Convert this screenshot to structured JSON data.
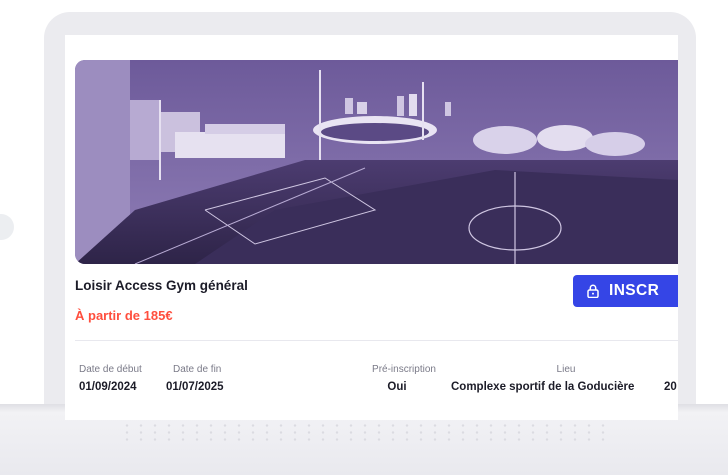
{
  "course": {
    "title": "Loisir Access Gym général",
    "price": "À partir de 185€"
  },
  "action": {
    "register_label": "INSCR",
    "icon": "lock-icon",
    "color": "#3545e6"
  },
  "details": {
    "start": {
      "label": "Date de début",
      "value": "01/09/2024"
    },
    "end": {
      "label": "Date de fin",
      "value": "01/07/2025"
    },
    "preregistration": {
      "label": "Pré-inscription",
      "value": "Oui"
    },
    "place": {
      "label": "Lieu",
      "value": "Complexe sportif de la Goducière"
    },
    "extra": {
      "value": "20"
    }
  },
  "colors": {
    "price": "#ff4e3d",
    "photo_tint": "#5a3f86"
  }
}
